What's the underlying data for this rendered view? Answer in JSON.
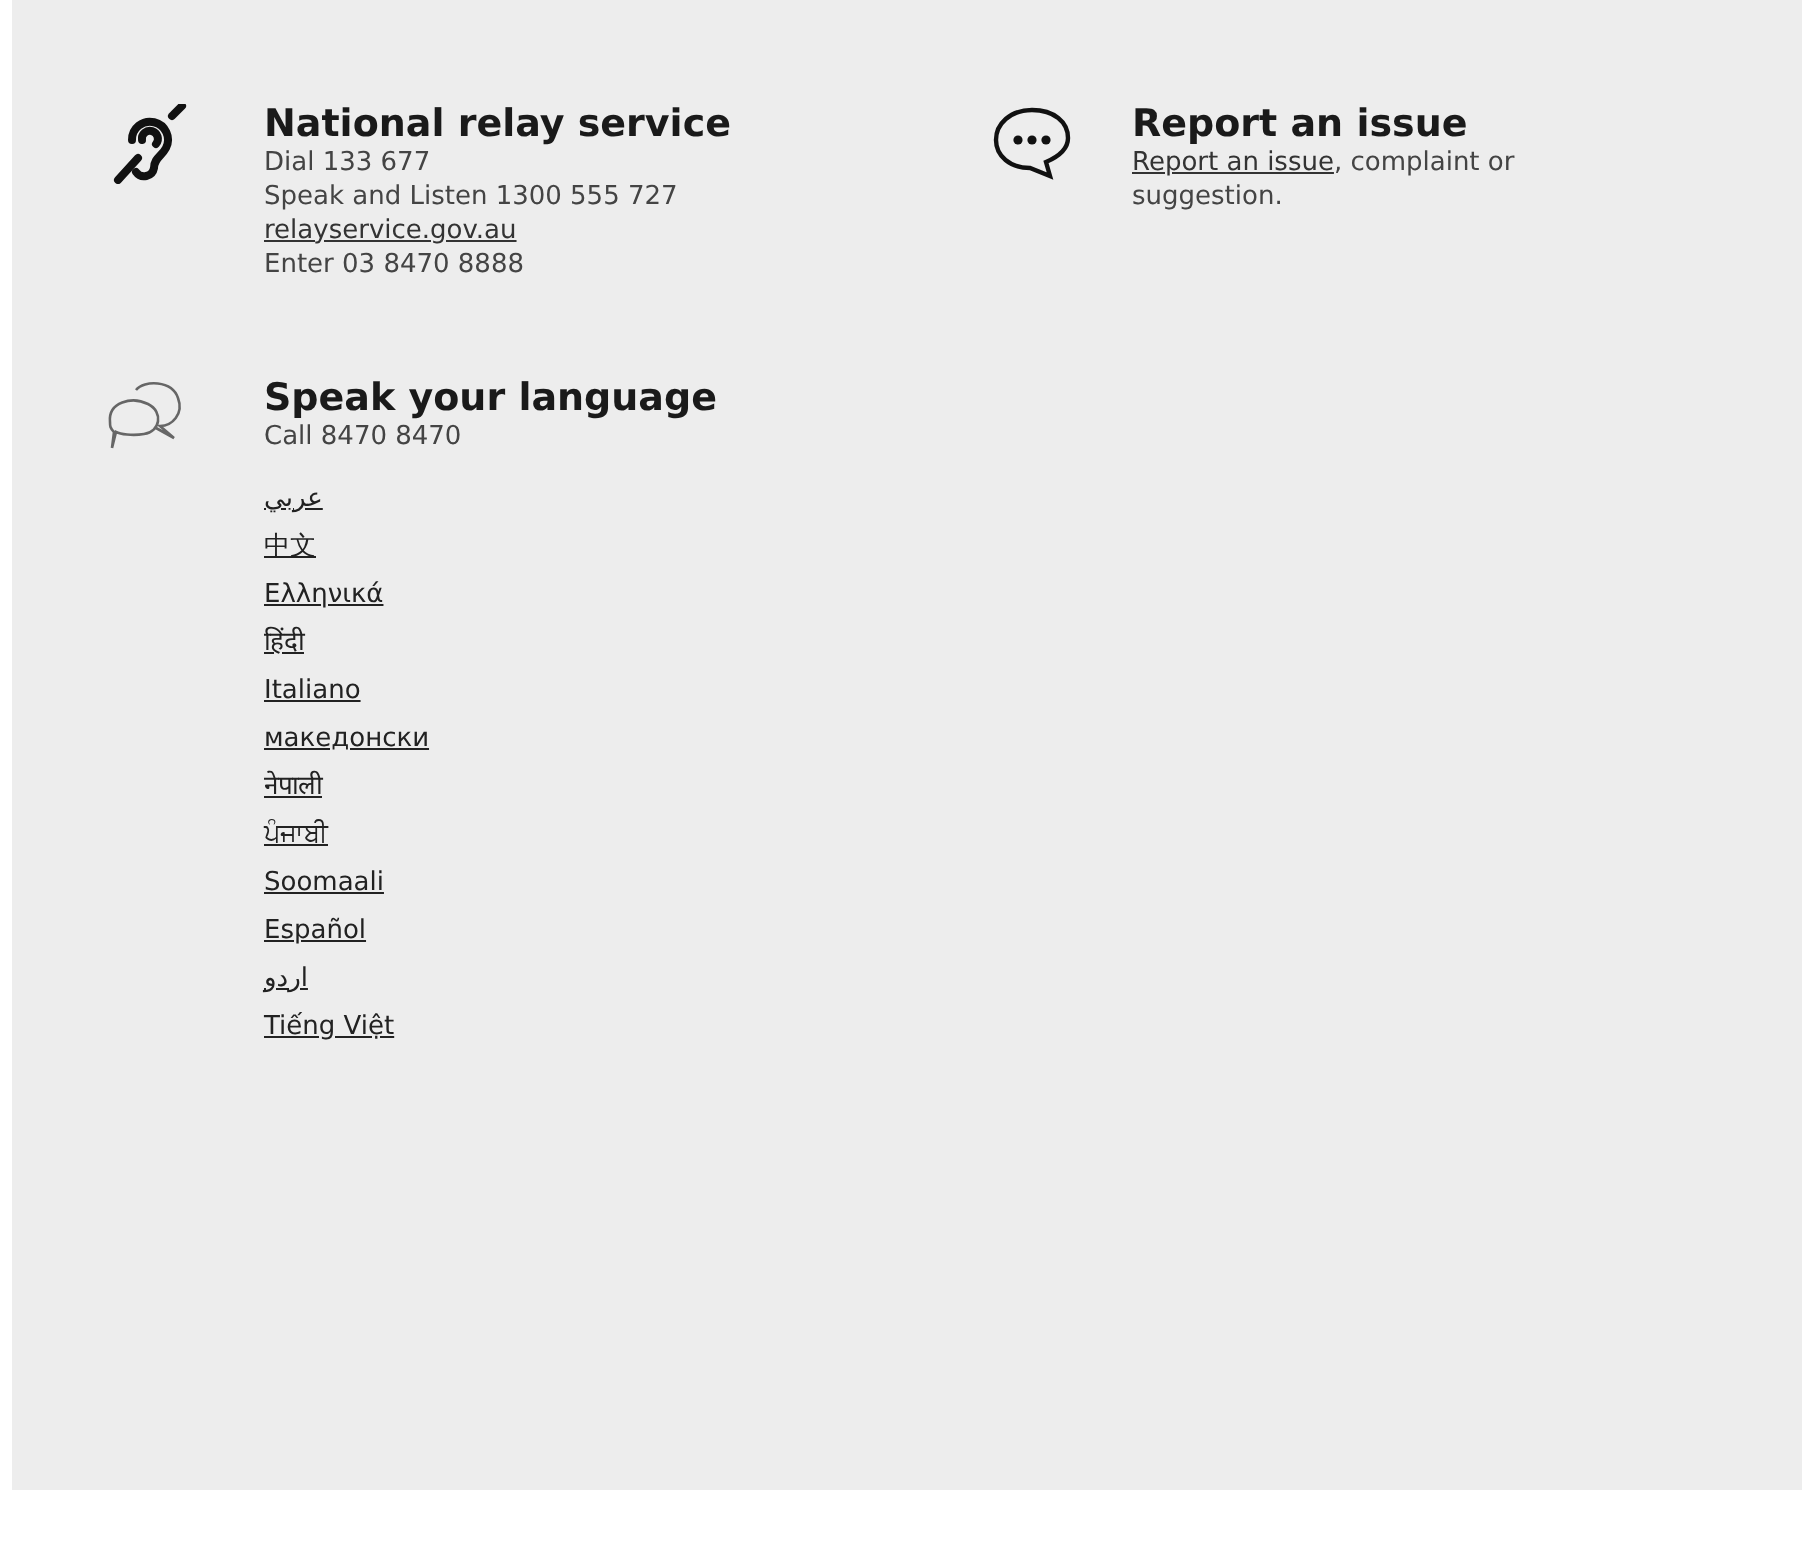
{
  "sections": [
    {
      "kind": "relay",
      "title": "National relay service",
      "lines": [
        {
          "text": "Dial 133 677",
          "link": false
        },
        {
          "text": "Speak and Listen 1300 555 727",
          "link": false
        },
        {
          "text": "relayservice.gov.au",
          "link": true
        },
        {
          "text": "Enter 03 8470 8888",
          "link": false
        }
      ]
    },
    {
      "kind": "report",
      "title": "Report an issue",
      "link": "Report an issue",
      "text": ", complaint or suggestion."
    },
    {
      "kind": "language",
      "title": "Speak your language",
      "lines": [
        {
          "text": "Call 8470 8470",
          "link": false
        }
      ],
      "languages": [
        "عربي",
        "中文",
        "Ελληνικά",
        "हिंदी",
        "Italiano",
        "македонски",
        "नेपाली",
        "ਪੰਜਾਬੀ",
        "Soomaali",
        "Español",
        "اردو",
        "Tiếng Việt"
      ]
    }
  ]
}
